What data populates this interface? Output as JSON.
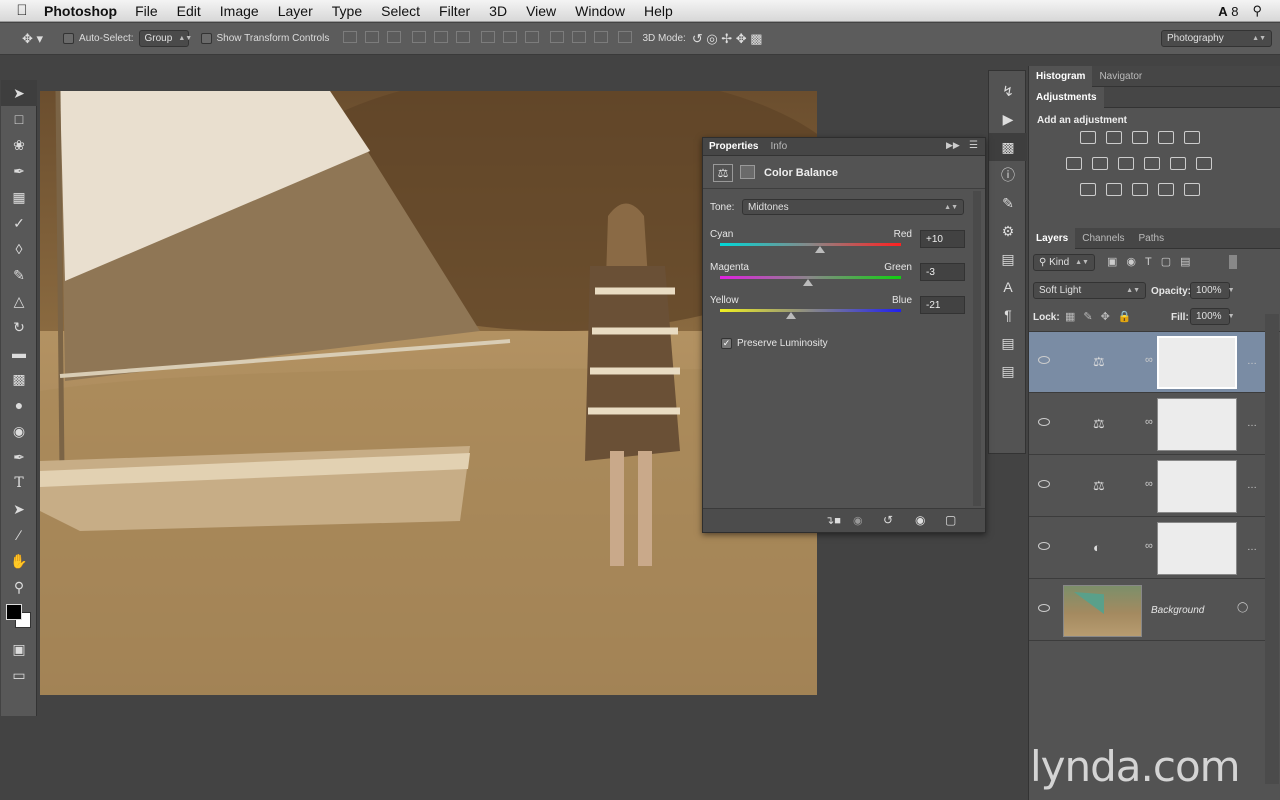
{
  "menubar": {
    "app": "Photoshop",
    "items": [
      "File",
      "Edit",
      "Image",
      "Layer",
      "Type",
      "Select",
      "Filter",
      "3D",
      "View",
      "Window",
      "Help"
    ],
    "status_count": "8"
  },
  "options": {
    "auto_select": "Auto-Select:",
    "auto_select_value": "Group",
    "transform": "Show Transform Controls",
    "mode_3d": "3D Mode:",
    "workspace": "Photography"
  },
  "properties": {
    "tabs": [
      "Properties",
      "Info"
    ],
    "title": "Color Balance",
    "tone_label": "Tone:",
    "tone_value": "Midtones",
    "sliders": [
      {
        "left": "Cyan",
        "right": "Red",
        "value": "+10",
        "pos": 10
      },
      {
        "left": "Magenta",
        "right": "Green",
        "value": "-3",
        "pos": -3
      },
      {
        "left": "Yellow",
        "right": "Blue",
        "value": "-21",
        "pos": -21
      }
    ],
    "preserve": "Preserve Luminosity"
  },
  "right": {
    "top_tabs": [
      "Histogram",
      "Navigator"
    ],
    "adj_tab": "Adjustments",
    "add_adjustment": "Add an adjustment",
    "layers_tabs": [
      "Layers",
      "Channels",
      "Paths"
    ],
    "kind": "Kind",
    "blend": "Soft Light",
    "opacity_label": "Opacity:",
    "opacity": "100%",
    "lock_label": "Lock:",
    "fill_label": "Fill:",
    "fill": "100%",
    "background": "Background"
  },
  "watermark": "lynda.com",
  "colors": {
    "selection": "#7a8ca4",
    "panel": "#535353"
  }
}
